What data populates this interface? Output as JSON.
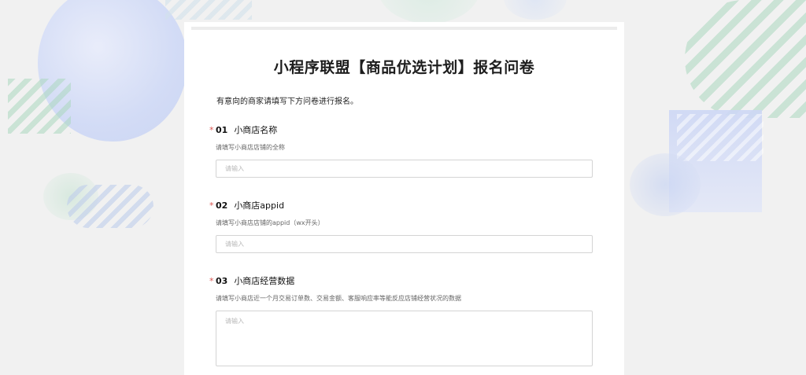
{
  "survey": {
    "title": "小程序联盟【商品优选计划】报名问卷",
    "intro": "有意向的商家请填写下方问卷进行报名。",
    "questions": [
      {
        "required_mark": "*",
        "number": "01",
        "title": "小商店名称",
        "description": "请填写小商店店铺的全称",
        "placeholder": "请输入",
        "value": ""
      },
      {
        "required_mark": "*",
        "number": "02",
        "title": "小商店appid",
        "description": "请填写小商店店铺的appid（wx开头）",
        "placeholder": "请输入",
        "value": ""
      },
      {
        "required_mark": "*",
        "number": "03",
        "title": "小商店经营数据",
        "description": "请填写小商店近一个月交易订单数、交易金额、客服响应率等能反应店铺经营状况的数据",
        "placeholder": "请输入",
        "value": ""
      }
    ]
  },
  "colors": {
    "required": "#d9534f",
    "page_background": "#f1f1f1",
    "card_background": "#ffffff"
  }
}
